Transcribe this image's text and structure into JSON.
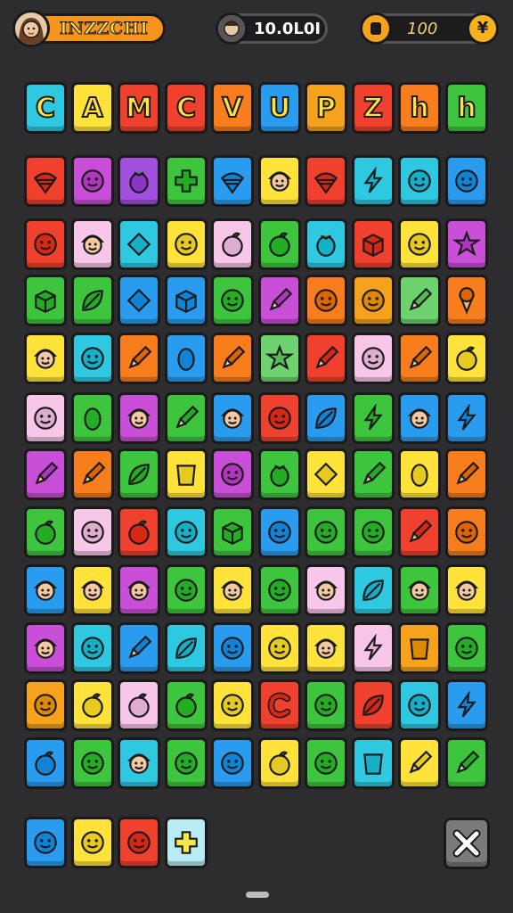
{
  "header": {
    "player_name": "INZZCHI",
    "score": "10.0L0I",
    "coins": "100",
    "badge_symbol": "¥"
  },
  "colors": {
    "background": "#2d2d2f",
    "accent_orange": "#f7941d",
    "letter_fill": "#ffe046"
  },
  "title_tiles": [
    {
      "letter": "C",
      "color": "#2ec8e0"
    },
    {
      "letter": "A",
      "color": "#ffe33a"
    },
    {
      "letter": "M",
      "color": "#f0402e"
    },
    {
      "letter": "C",
      "color": "#f0402e"
    },
    {
      "letter": "V",
      "color": "#f77d1d"
    },
    {
      "letter": "U",
      "color": "#2a9cf0"
    },
    {
      "letter": "P",
      "color": "#f7a21d"
    },
    {
      "letter": "Z",
      "color": "#f0402e"
    },
    {
      "letter": "h",
      "color": "#f77d1d"
    },
    {
      "letter": "h",
      "color": "#3ec53e"
    }
  ],
  "board_rows": [
    [
      {
        "icon": "spinning-top",
        "color": "#f0402e"
      },
      {
        "icon": "smiley",
        "color": "#c94fd8"
      },
      {
        "icon": "berry",
        "color": "#a24fe0"
      },
      {
        "icon": "plus",
        "color": "#3ec53e"
      },
      {
        "icon": "spinning-top",
        "color": "#2a9cf0"
      },
      {
        "icon": "face",
        "color": "#ffe33a"
      },
      {
        "icon": "spinning-top",
        "color": "#f0402e"
      },
      {
        "icon": "bolt",
        "color": "#2ec8e0"
      },
      {
        "icon": "smiley",
        "color": "#2ec8e0"
      },
      {
        "icon": "smiley",
        "color": "#2a9cf0"
      }
    ],
    [
      {
        "icon": "smiley",
        "color": "#f0402e"
      },
      {
        "icon": "face",
        "color": "#f7c6e8"
      },
      {
        "icon": "diamond",
        "color": "#2ec8e0"
      },
      {
        "icon": "smiley",
        "color": "#ffe33a"
      },
      {
        "icon": "fruit",
        "color": "#f7c6e8"
      },
      {
        "icon": "fruit",
        "color": "#3ec53e"
      },
      {
        "icon": "berry",
        "color": "#2ec8e0"
      },
      {
        "icon": "box",
        "color": "#f0402e"
      },
      {
        "icon": "smiley",
        "color": "#ffe33a"
      },
      {
        "icon": "star",
        "color": "#c94fd8"
      }
    ],
    [
      {
        "icon": "box",
        "color": "#3ec53e"
      },
      {
        "icon": "leaf",
        "color": "#3ec53e"
      },
      {
        "icon": "diamond",
        "color": "#2a9cf0"
      },
      {
        "icon": "box",
        "color": "#2a9cf0"
      },
      {
        "icon": "smiley",
        "color": "#3ec53e"
      },
      {
        "icon": "pencil",
        "color": "#c94fd8"
      },
      {
        "icon": "smiley",
        "color": "#f77d1d"
      },
      {
        "icon": "smiley",
        "color": "#f7a21d"
      },
      {
        "icon": "pencil",
        "color": "#6ed36e"
      },
      {
        "icon": "cone",
        "color": "#f77d1d"
      }
    ],
    [
      {
        "icon": "face",
        "color": "#ffe33a"
      },
      {
        "icon": "smiley",
        "color": "#2ec8e0"
      },
      {
        "icon": "pencil",
        "color": "#f77d1d"
      },
      {
        "icon": "egg",
        "color": "#2a9cf0"
      },
      {
        "icon": "pencil",
        "color": "#f77d1d"
      },
      {
        "icon": "star",
        "color": "#6ed36e"
      },
      {
        "icon": "pencil",
        "color": "#f0402e"
      },
      {
        "icon": "smiley",
        "color": "#f7c6e8"
      },
      {
        "icon": "pencil",
        "color": "#f77d1d"
      },
      {
        "icon": "fruit",
        "color": "#ffe33a"
      }
    ],
    [
      {
        "icon": "smiley",
        "color": "#f7c6e8"
      },
      {
        "icon": "egg",
        "color": "#3ec53e"
      },
      {
        "icon": "face",
        "color": "#c94fd8"
      },
      {
        "icon": "pencil",
        "color": "#3ec53e"
      },
      {
        "icon": "face",
        "color": "#2a9cf0"
      },
      {
        "icon": "smiley",
        "color": "#f0402e"
      },
      {
        "icon": "leaf",
        "color": "#2a9cf0"
      },
      {
        "icon": "bolt",
        "color": "#3ec53e"
      },
      {
        "icon": "face",
        "color": "#2a9cf0"
      },
      {
        "icon": "bolt",
        "color": "#2a9cf0"
      }
    ],
    [
      {
        "icon": "pencil",
        "color": "#c94fd8"
      },
      {
        "icon": "pencil",
        "color": "#f77d1d"
      },
      {
        "icon": "leaf",
        "color": "#3ec53e"
      },
      {
        "icon": "cup",
        "color": "#ffe33a"
      },
      {
        "icon": "smiley",
        "color": "#c94fd8"
      },
      {
        "icon": "berry",
        "color": "#3ec53e"
      },
      {
        "icon": "diamond",
        "color": "#ffe33a"
      },
      {
        "icon": "pencil",
        "color": "#3ec53e"
      },
      {
        "icon": "egg",
        "color": "#ffe33a"
      },
      {
        "icon": "pencil",
        "color": "#f77d1d"
      }
    ],
    [
      {
        "icon": "fruit",
        "color": "#3ec53e"
      },
      {
        "icon": "smiley",
        "color": "#f7c6e8"
      },
      {
        "icon": "fruit",
        "color": "#f0402e"
      },
      {
        "icon": "smiley",
        "color": "#2ec8e0"
      },
      {
        "icon": "box",
        "color": "#3ec53e"
      },
      {
        "icon": "smiley",
        "color": "#2a9cf0"
      },
      {
        "icon": "smiley",
        "color": "#3ec53e"
      },
      {
        "icon": "smiley",
        "color": "#3ec53e"
      },
      {
        "icon": "pencil",
        "color": "#f0402e"
      },
      {
        "icon": "smiley",
        "color": "#f77d1d"
      }
    ],
    [
      {
        "icon": "face",
        "color": "#2a9cf0"
      },
      {
        "icon": "face",
        "color": "#ffe33a"
      },
      {
        "icon": "face",
        "color": "#c94fd8"
      },
      {
        "icon": "smiley",
        "color": "#3ec53e"
      },
      {
        "icon": "face",
        "color": "#ffe33a"
      },
      {
        "icon": "smiley",
        "color": "#3ec53e"
      },
      {
        "icon": "face",
        "color": "#f7c6e8"
      },
      {
        "icon": "leaf",
        "color": "#2ec8e0"
      },
      {
        "icon": "face",
        "color": "#3ec53e"
      },
      {
        "icon": "face",
        "color": "#ffe33a"
      }
    ],
    [
      {
        "icon": "face",
        "color": "#c94fd8"
      },
      {
        "icon": "smiley",
        "color": "#2ec8e0"
      },
      {
        "icon": "pencil",
        "color": "#2a9cf0"
      },
      {
        "icon": "leaf",
        "color": "#2ec8e0"
      },
      {
        "icon": "smiley",
        "color": "#2a9cf0"
      },
      {
        "icon": "smiley",
        "color": "#ffe33a"
      },
      {
        "icon": "face",
        "color": "#ffe33a"
      },
      {
        "icon": "bolt",
        "color": "#f7c6e8"
      },
      {
        "icon": "cup",
        "color": "#f7a21d"
      },
      {
        "icon": "smiley",
        "color": "#3ec53e"
      }
    ],
    [
      {
        "icon": "smiley",
        "color": "#f7a21d"
      },
      {
        "icon": "fruit",
        "color": "#ffe33a"
      },
      {
        "icon": "fruit",
        "color": "#f7c6e8"
      },
      {
        "icon": "fruit",
        "color": "#3ec53e"
      },
      {
        "icon": "smiley",
        "color": "#ffe33a"
      },
      {
        "icon": "letter-c",
        "color": "#f0402e"
      },
      {
        "icon": "smiley",
        "color": "#3ec53e"
      },
      {
        "icon": "leaf",
        "color": "#f0402e"
      },
      {
        "icon": "smiley",
        "color": "#2ec8e0"
      },
      {
        "icon": "bolt",
        "color": "#2a9cf0"
      }
    ],
    [
      {
        "icon": "fruit",
        "color": "#2a9cf0"
      },
      {
        "icon": "smiley",
        "color": "#3ec53e"
      },
      {
        "icon": "face",
        "color": "#2ec8e0"
      },
      {
        "icon": "smiley",
        "color": "#3ec53e"
      },
      {
        "icon": "smiley",
        "color": "#2a9cf0"
      },
      {
        "icon": "fruit",
        "color": "#ffe33a"
      },
      {
        "icon": "smiley",
        "color": "#3ec53e"
      },
      {
        "icon": "cup",
        "color": "#2ec8e0"
      },
      {
        "icon": "pencil",
        "color": "#ffe33a"
      },
      {
        "icon": "pencil",
        "color": "#3ec53e"
      }
    ]
  ],
  "tray": [
    {
      "icon": "smiley",
      "color": "#2a9cf0"
    },
    {
      "icon": "smiley",
      "color": "#ffe33a"
    },
    {
      "icon": "smiley",
      "color": "#f0402e"
    },
    {
      "icon": "plus",
      "color": "#b9ecf5"
    }
  ],
  "close_button": {
    "icon": "close-icon"
  }
}
